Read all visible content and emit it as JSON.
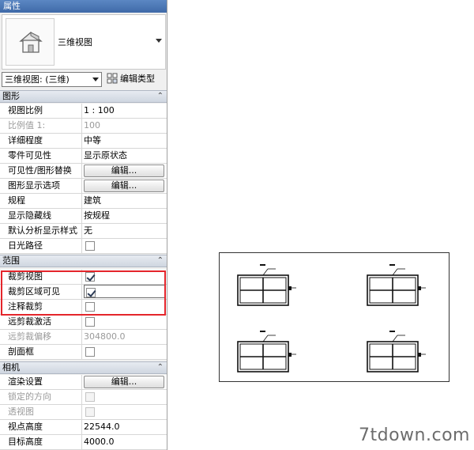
{
  "panel": {
    "title": "属性",
    "type_name": "三维视图",
    "view_selector": "三维视图: (三维)",
    "edit_type_label": "编辑类型"
  },
  "sections": {
    "graphics": "图形",
    "extents": "范围",
    "camera": "相机"
  },
  "graphics_rows": [
    {
      "label": "视图比例",
      "value": "1 : 100"
    },
    {
      "label": "比例值 1:",
      "value": "100"
    },
    {
      "label": "详细程度",
      "value": "中等"
    },
    {
      "label": "零件可见性",
      "value": "显示原状态"
    },
    {
      "label": "可见性/图形替换",
      "value": "编辑..."
    },
    {
      "label": "图形显示选项",
      "value": "编辑..."
    },
    {
      "label": "规程",
      "value": "建筑"
    },
    {
      "label": "显示隐藏线",
      "value": "按规程"
    },
    {
      "label": "默认分析显示样式",
      "value": "无"
    },
    {
      "label": "日光路径",
      "value": ""
    }
  ],
  "extents_rows": [
    {
      "label": "裁剪视图",
      "checked": true
    },
    {
      "label": "裁剪区域可见",
      "checked": true
    },
    {
      "label": "注释裁剪",
      "checked": false
    },
    {
      "label": "远剪裁激活",
      "checked": false
    },
    {
      "label": "远剪裁偏移",
      "value": "304800.0"
    },
    {
      "label": "剖面框",
      "checked": false
    }
  ],
  "camera_rows": [
    {
      "label": "渲染设置",
      "value": "编辑..."
    },
    {
      "label": "锁定的方向",
      "value": ""
    },
    {
      "label": "透视图",
      "value": ""
    },
    {
      "label": "视点高度",
      "value": "22544.0"
    },
    {
      "label": "目标高度",
      "value": "4000.0"
    }
  ],
  "collapse_glyph": "⌃",
  "watermark": "7tdown.com",
  "colors": {
    "title_bar": "#4a77b8",
    "highlight_frame": "#e4252b"
  }
}
